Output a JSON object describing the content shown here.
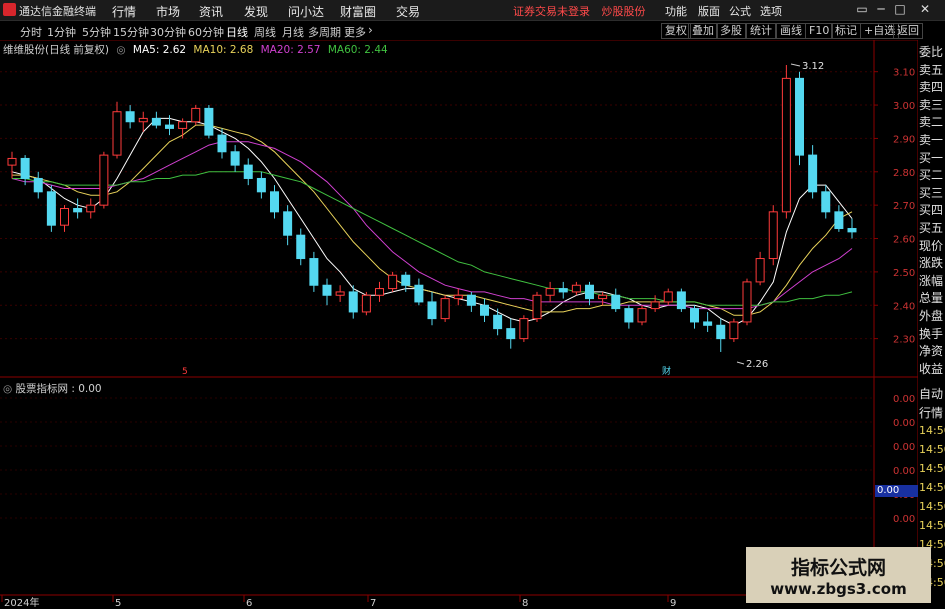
{
  "app": {
    "name": "通达信金融终端",
    "menus": [
      "行情",
      "市场",
      "资讯",
      "发现",
      "问小达",
      "财富圈",
      "交易"
    ],
    "notice": "证券交易未登录",
    "account_label": "炒股股份",
    "right_menus": [
      "功能",
      "版面",
      "公式",
      "选项"
    ],
    "window_buttons": [
      "▭",
      "─",
      "□",
      "✕"
    ]
  },
  "toolbar": {
    "periods": [
      "分时",
      "1分钟",
      "5分钟",
      "15分钟",
      "30分钟",
      "60分钟",
      "日线",
      "周线",
      "月线",
      "多周期",
      "更多"
    ],
    "active_period": "日线",
    "more_icon": "chevron-right-icon",
    "right_buttons": [
      "复权",
      "叠加",
      "多股",
      "统计",
      "画线",
      "F10",
      "标记",
      "+自选",
      "返回"
    ]
  },
  "main_chart": {
    "stock": "维维股份(日线 前复权)",
    "legend": [
      {
        "label": "MA5: 2.62",
        "color": "#ffffff"
      },
      {
        "label": "MA10: 2.68",
        "color": "#e8d25a"
      },
      {
        "label": "MA20: 2.57",
        "color": "#d040d0"
      },
      {
        "label": "MA60: 2.44",
        "color": "#40c040"
      }
    ],
    "high_marker": "3.12",
    "low_marker": "2.26",
    "event_markers": [
      "5",
      "财"
    ],
    "y_ticks": [
      "3.10",
      "3.00",
      "2.90",
      "2.80",
      "2.70",
      "2.60",
      "2.50",
      "2.40",
      "2.30"
    ]
  },
  "indicator": {
    "label": "股票指标网 : 0.00",
    "y_ticks": [
      "0.00",
      "0.00",
      "0.00",
      "0.00",
      "0.00",
      "0.00"
    ],
    "current_value": "0.00"
  },
  "x_axis": {
    "labels": [
      "2024年",
      "5",
      "6",
      "7",
      "8",
      "9"
    ]
  },
  "quote_panel": {
    "rows": [
      "委比",
      "卖五",
      "卖四",
      "卖三",
      "卖二",
      "卖一",
      "买一",
      "买二",
      "买三",
      "买四",
      "买五",
      "现价",
      "涨跌",
      "涨幅",
      "总量",
      "外盘",
      "换手",
      "净资",
      "收益"
    ],
    "lower": [
      "自动",
      "行情",
      "14:50",
      "14:50",
      "14:50",
      "14:50",
      "14:50",
      "14:50",
      "14:50",
      "14:50",
      "14:50"
    ]
  },
  "colors": {
    "up": "#ff3b3b",
    "down": "#54d8f0",
    "grid": "#5a0000",
    "axis_text": "#cc3333",
    "ma5": "#ffffff",
    "ma10": "#e8d25a",
    "ma20": "#d040d0",
    "ma60": "#40c040"
  },
  "chart_data": {
    "type": "candlestick",
    "title": "维维股份(日线 前复权)",
    "y_range": [
      2.2,
      3.18
    ],
    "x_labels": [
      "2024年",
      "5",
      "6",
      "7",
      "8",
      "9"
    ],
    "ohlc": [
      [
        2.82,
        2.86,
        2.78,
        2.84
      ],
      [
        2.84,
        2.85,
        2.76,
        2.78
      ],
      [
        2.78,
        2.8,
        2.72,
        2.74
      ],
      [
        2.74,
        2.76,
        2.62,
        2.64
      ],
      [
        2.64,
        2.7,
        2.62,
        2.69
      ],
      [
        2.69,
        2.72,
        2.66,
        2.68
      ],
      [
        2.68,
        2.72,
        2.66,
        2.7
      ],
      [
        2.7,
        2.86,
        2.69,
        2.85
      ],
      [
        2.85,
        3.01,
        2.84,
        2.98
      ],
      [
        2.98,
        3.0,
        2.93,
        2.95
      ],
      [
        2.95,
        2.98,
        2.92,
        2.96
      ],
      [
        2.96,
        2.98,
        2.93,
        2.94
      ],
      [
        2.94,
        2.97,
        2.91,
        2.93
      ],
      [
        2.93,
        2.96,
        2.9,
        2.95
      ],
      [
        2.95,
        3.0,
        2.94,
        2.99
      ],
      [
        2.99,
        3.0,
        2.9,
        2.91
      ],
      [
        2.91,
        2.93,
        2.84,
        2.86
      ],
      [
        2.86,
        2.88,
        2.8,
        2.82
      ],
      [
        2.82,
        2.84,
        2.76,
        2.78
      ],
      [
        2.78,
        2.8,
        2.72,
        2.74
      ],
      [
        2.74,
        2.76,
        2.66,
        2.68
      ],
      [
        2.68,
        2.7,
        2.58,
        2.61
      ],
      [
        2.61,
        2.63,
        2.52,
        2.54
      ],
      [
        2.54,
        2.56,
        2.44,
        2.46
      ],
      [
        2.46,
        2.48,
        2.4,
        2.43
      ],
      [
        2.43,
        2.46,
        2.41,
        2.44
      ],
      [
        2.44,
        2.46,
        2.36,
        2.38
      ],
      [
        2.38,
        2.44,
        2.37,
        2.43
      ],
      [
        2.43,
        2.47,
        2.41,
        2.45
      ],
      [
        2.45,
        2.5,
        2.44,
        2.49
      ],
      [
        2.49,
        2.5,
        2.44,
        2.46
      ],
      [
        2.46,
        2.48,
        2.4,
        2.41
      ],
      [
        2.41,
        2.44,
        2.34,
        2.36
      ],
      [
        2.36,
        2.43,
        2.35,
        2.42
      ],
      [
        2.42,
        2.45,
        2.4,
        2.43
      ],
      [
        2.43,
        2.44,
        2.38,
        2.4
      ],
      [
        2.4,
        2.42,
        2.35,
        2.37
      ],
      [
        2.37,
        2.39,
        2.31,
        2.33
      ],
      [
        2.33,
        2.36,
        2.27,
        2.3
      ],
      [
        2.3,
        2.37,
        2.29,
        2.36
      ],
      [
        2.36,
        2.44,
        2.35,
        2.43
      ],
      [
        2.43,
        2.47,
        2.41,
        2.45
      ],
      [
        2.45,
        2.47,
        2.42,
        2.44
      ],
      [
        2.44,
        2.47,
        2.43,
        2.46
      ],
      [
        2.46,
        2.47,
        2.4,
        2.42
      ],
      [
        2.42,
        2.44,
        2.4,
        2.43
      ],
      [
        2.43,
        2.45,
        2.38,
        2.39
      ],
      [
        2.39,
        2.4,
        2.33,
        2.35
      ],
      [
        2.35,
        2.4,
        2.34,
        2.39
      ],
      [
        2.39,
        2.43,
        2.38,
        2.41
      ],
      [
        2.41,
        2.45,
        2.4,
        2.44
      ],
      [
        2.44,
        2.45,
        2.38,
        2.39
      ],
      [
        2.39,
        2.4,
        2.33,
        2.35
      ],
      [
        2.35,
        2.38,
        2.32,
        2.34
      ],
      [
        2.34,
        2.36,
        2.26,
        2.3
      ],
      [
        2.3,
        2.36,
        2.29,
        2.35
      ],
      [
        2.35,
        2.48,
        2.34,
        2.47
      ],
      [
        2.47,
        2.56,
        2.46,
        2.54
      ],
      [
        2.54,
        2.7,
        2.52,
        2.68
      ],
      [
        2.68,
        3.12,
        2.66,
        3.08
      ],
      [
        3.08,
        3.1,
        2.82,
        2.85
      ],
      [
        2.85,
        2.88,
        2.72,
        2.74
      ],
      [
        2.74,
        2.76,
        2.66,
        2.68
      ],
      [
        2.68,
        2.7,
        2.62,
        2.63
      ],
      [
        2.63,
        2.66,
        2.6,
        2.62
      ]
    ],
    "series": [
      {
        "name": "MA5",
        "values": [
          2.8,
          2.79,
          2.78,
          2.75,
          2.72,
          2.7,
          2.69,
          2.72,
          2.78,
          2.85,
          2.92,
          2.96,
          2.96,
          2.95,
          2.95,
          2.94,
          2.92,
          2.9,
          2.87,
          2.83,
          2.78,
          2.72,
          2.66,
          2.6,
          2.54,
          2.5,
          2.45,
          2.43,
          2.43,
          2.44,
          2.45,
          2.45,
          2.44,
          2.43,
          2.42,
          2.41,
          2.4,
          2.38,
          2.36,
          2.35,
          2.36,
          2.38,
          2.41,
          2.43,
          2.44,
          2.44,
          2.43,
          2.42,
          2.4,
          2.39,
          2.4,
          2.4,
          2.4,
          2.39,
          2.36,
          2.34,
          2.36,
          2.41,
          2.47,
          2.62,
          2.72,
          2.76,
          2.76,
          2.71,
          2.66
        ]
      },
      {
        "name": "MA10",
        "values": [
          2.79,
          2.79,
          2.78,
          2.77,
          2.76,
          2.74,
          2.73,
          2.73,
          2.74,
          2.77,
          2.81,
          2.85,
          2.89,
          2.91,
          2.94,
          2.94,
          2.93,
          2.92,
          2.91,
          2.89,
          2.86,
          2.82,
          2.78,
          2.74,
          2.69,
          2.64,
          2.59,
          2.55,
          2.51,
          2.48,
          2.46,
          2.45,
          2.44,
          2.43,
          2.43,
          2.43,
          2.42,
          2.41,
          2.4,
          2.39,
          2.38,
          2.38,
          2.38,
          2.39,
          2.39,
          2.4,
          2.4,
          2.41,
          2.41,
          2.41,
          2.41,
          2.41,
          2.41,
          2.4,
          2.39,
          2.37,
          2.37,
          2.38,
          2.41,
          2.46,
          2.52,
          2.57,
          2.61,
          2.66,
          2.68
        ]
      },
      {
        "name": "MA20",
        "values": [
          2.78,
          2.77,
          2.77,
          2.76,
          2.75,
          2.75,
          2.75,
          2.75,
          2.76,
          2.77,
          2.78,
          2.8,
          2.82,
          2.84,
          2.86,
          2.88,
          2.89,
          2.89,
          2.89,
          2.88,
          2.87,
          2.85,
          2.83,
          2.8,
          2.77,
          2.73,
          2.69,
          2.64,
          2.6,
          2.56,
          2.53,
          2.5,
          2.48,
          2.46,
          2.45,
          2.44,
          2.44,
          2.43,
          2.42,
          2.42,
          2.41,
          2.41,
          2.41,
          2.41,
          2.41,
          2.41,
          2.4,
          2.4,
          2.4,
          2.4,
          2.4,
          2.4,
          2.39,
          2.39,
          2.39,
          2.39,
          2.39,
          2.4,
          2.41,
          2.44,
          2.47,
          2.5,
          2.52,
          2.54,
          2.57
        ]
      },
      {
        "name": "MA60",
        "values": [
          2.78,
          2.78,
          2.77,
          2.77,
          2.76,
          2.76,
          2.76,
          2.76,
          2.76,
          2.77,
          2.77,
          2.78,
          2.78,
          2.79,
          2.79,
          2.8,
          2.8,
          2.8,
          2.8,
          2.8,
          2.79,
          2.78,
          2.77,
          2.75,
          2.73,
          2.71,
          2.69,
          2.67,
          2.65,
          2.63,
          2.61,
          2.59,
          2.57,
          2.55,
          2.53,
          2.52,
          2.5,
          2.49,
          2.48,
          2.47,
          2.46,
          2.45,
          2.45,
          2.44,
          2.44,
          2.43,
          2.43,
          2.42,
          2.42,
          2.42,
          2.41,
          2.41,
          2.41,
          2.4,
          2.4,
          2.4,
          2.4,
          2.4,
          2.41,
          2.41,
          2.42,
          2.42,
          2.43,
          2.43,
          2.44
        ]
      }
    ]
  }
}
